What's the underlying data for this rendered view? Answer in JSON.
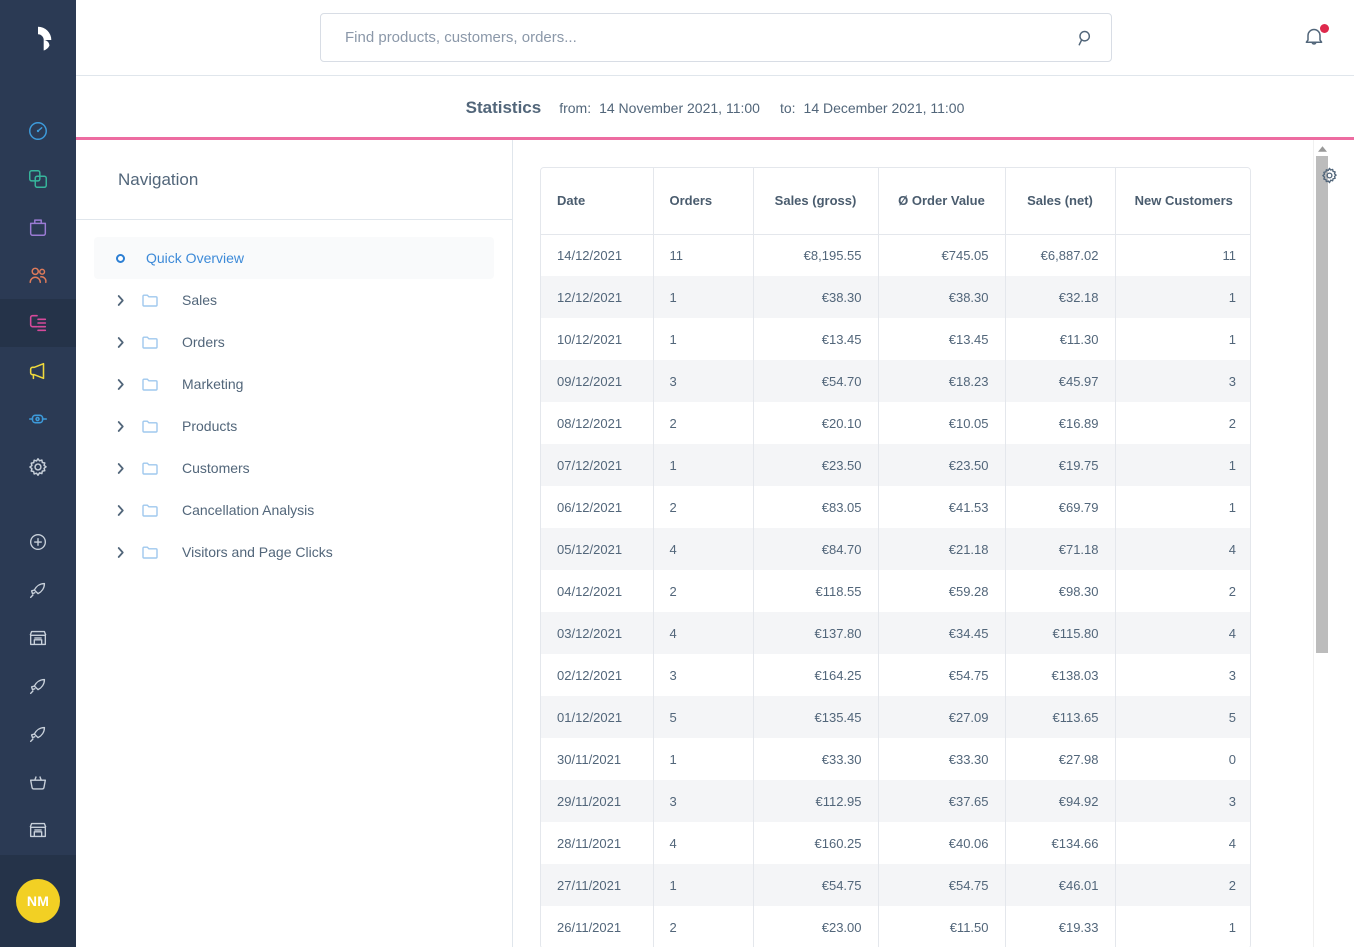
{
  "app": {
    "logo_name": "shopware-logo"
  },
  "search": {
    "placeholder": "Find products, customers, orders...",
    "value": "",
    "icon": "search-icon"
  },
  "notifications": {
    "icon": "bell-icon",
    "has_unread": true,
    "dot_color": "#de294c"
  },
  "rail": {
    "items": [
      {
        "name": "dashboard",
        "icon": "dashboard-icon",
        "color": "#3d9bdb",
        "active": false
      },
      {
        "name": "catalogues",
        "icon": "copy-icon",
        "color": "#37b59c",
        "active": false
      },
      {
        "name": "orders",
        "icon": "bag-icon",
        "color": "#9b7bd4",
        "active": false
      },
      {
        "name": "customers",
        "icon": "users-icon",
        "color": "#e07b5a",
        "active": false
      },
      {
        "name": "content",
        "icon": "content-icon",
        "color": "#d64a9b",
        "active": true
      },
      {
        "name": "marketing",
        "icon": "megaphone-icon",
        "color": "#f0d93c",
        "active": false
      },
      {
        "name": "extensions",
        "icon": "plug-icon",
        "color": "#3d9bdb",
        "active": false
      },
      {
        "name": "settings",
        "icon": "gear-icon",
        "color": "#c8d0da",
        "active": false
      },
      {
        "name": "add-plugin",
        "icon": "plus-circle-icon",
        "color": "#c8d0da",
        "active": false
      },
      {
        "name": "rocket-1",
        "icon": "rocket-icon",
        "color": "#c8d0da",
        "active": false
      },
      {
        "name": "store-1",
        "icon": "store-icon",
        "color": "#c8d0da",
        "active": false
      },
      {
        "name": "rocket-2",
        "icon": "rocket-icon",
        "color": "#c8d0da",
        "active": false
      },
      {
        "name": "rocket-3",
        "icon": "rocket-icon",
        "color": "#c8d0da",
        "active": false
      },
      {
        "name": "basket",
        "icon": "basket-icon",
        "color": "#c8d0da",
        "active": false
      },
      {
        "name": "store-2",
        "icon": "store-icon",
        "color": "#c8d0da",
        "active": false
      },
      {
        "name": "expand",
        "icon": "chevron-right-circle-icon",
        "color": "#c8d0da",
        "active": false
      }
    ],
    "avatar_initials": "NM",
    "avatar_color": "#f2d024"
  },
  "statistics": {
    "title": "Statistics",
    "from_label": "from:",
    "from_value": "14 November 2021, 11:00",
    "to_label": "to:",
    "to_value": "14 December 2021, 11:00",
    "progress_color": "#ed6ca1"
  },
  "navigation": {
    "title": "Navigation",
    "items": [
      {
        "label": "Quick Overview",
        "type": "leaf",
        "active": true
      },
      {
        "label": "Sales",
        "type": "folder",
        "active": false
      },
      {
        "label": "Orders",
        "type": "folder",
        "active": false
      },
      {
        "label": "Marketing",
        "type": "folder",
        "active": false
      },
      {
        "label": "Products",
        "type": "folder",
        "active": false
      },
      {
        "label": "Customers",
        "type": "folder",
        "active": false
      },
      {
        "label": "Cancellation Analysis",
        "type": "folder",
        "active": false
      },
      {
        "label": "Visitors and Page Clicks",
        "type": "folder",
        "active": false
      }
    ]
  },
  "settings_button": {
    "icon": "gear-icon"
  },
  "table": {
    "columns": [
      "Date",
      "Orders",
      "Sales (gross)",
      "Ø Order Value",
      "Sales (net)",
      "New Customers"
    ],
    "rows": [
      {
        "date": "14/12/2021",
        "orders": "11",
        "gross": "€8,195.55",
        "avg": "€745.05",
        "net": "€6,887.02",
        "new_customers": "11"
      },
      {
        "date": "12/12/2021",
        "orders": "1",
        "gross": "€38.30",
        "avg": "€38.30",
        "net": "€32.18",
        "new_customers": "1"
      },
      {
        "date": "10/12/2021",
        "orders": "1",
        "gross": "€13.45",
        "avg": "€13.45",
        "net": "€11.30",
        "new_customers": "1"
      },
      {
        "date": "09/12/2021",
        "orders": "3",
        "gross": "€54.70",
        "avg": "€18.23",
        "net": "€45.97",
        "new_customers": "3"
      },
      {
        "date": "08/12/2021",
        "orders": "2",
        "gross": "€20.10",
        "avg": "€10.05",
        "net": "€16.89",
        "new_customers": "2"
      },
      {
        "date": "07/12/2021",
        "orders": "1",
        "gross": "€23.50",
        "avg": "€23.50",
        "net": "€19.75",
        "new_customers": "1"
      },
      {
        "date": "06/12/2021",
        "orders": "2",
        "gross": "€83.05",
        "avg": "€41.53",
        "net": "€69.79",
        "new_customers": "1"
      },
      {
        "date": "05/12/2021",
        "orders": "4",
        "gross": "€84.70",
        "avg": "€21.18",
        "net": "€71.18",
        "new_customers": "4"
      },
      {
        "date": "04/12/2021",
        "orders": "2",
        "gross": "€118.55",
        "avg": "€59.28",
        "net": "€98.30",
        "new_customers": "2"
      },
      {
        "date": "03/12/2021",
        "orders": "4",
        "gross": "€137.80",
        "avg": "€34.45",
        "net": "€115.80",
        "new_customers": "4"
      },
      {
        "date": "02/12/2021",
        "orders": "3",
        "gross": "€164.25",
        "avg": "€54.75",
        "net": "€138.03",
        "new_customers": "3"
      },
      {
        "date": "01/12/2021",
        "orders": "5",
        "gross": "€135.45",
        "avg": "€27.09",
        "net": "€113.65",
        "new_customers": "5"
      },
      {
        "date": "30/11/2021",
        "orders": "1",
        "gross": "€33.30",
        "avg": "€33.30",
        "net": "€27.98",
        "new_customers": "0"
      },
      {
        "date": "29/11/2021",
        "orders": "3",
        "gross": "€112.95",
        "avg": "€37.65",
        "net": "€94.92",
        "new_customers": "3"
      },
      {
        "date": "28/11/2021",
        "orders": "4",
        "gross": "€160.25",
        "avg": "€40.06",
        "net": "€134.66",
        "new_customers": "4"
      },
      {
        "date": "27/11/2021",
        "orders": "1",
        "gross": "€54.75",
        "avg": "€54.75",
        "net": "€46.01",
        "new_customers": "2"
      },
      {
        "date": "26/11/2021",
        "orders": "2",
        "gross": "€23.00",
        "avg": "€11.50",
        "net": "€19.33",
        "new_customers": "1"
      }
    ]
  },
  "scrollbar": {
    "name": "vertical-scrollbar",
    "up_arrow": "chevron-up-icon"
  }
}
